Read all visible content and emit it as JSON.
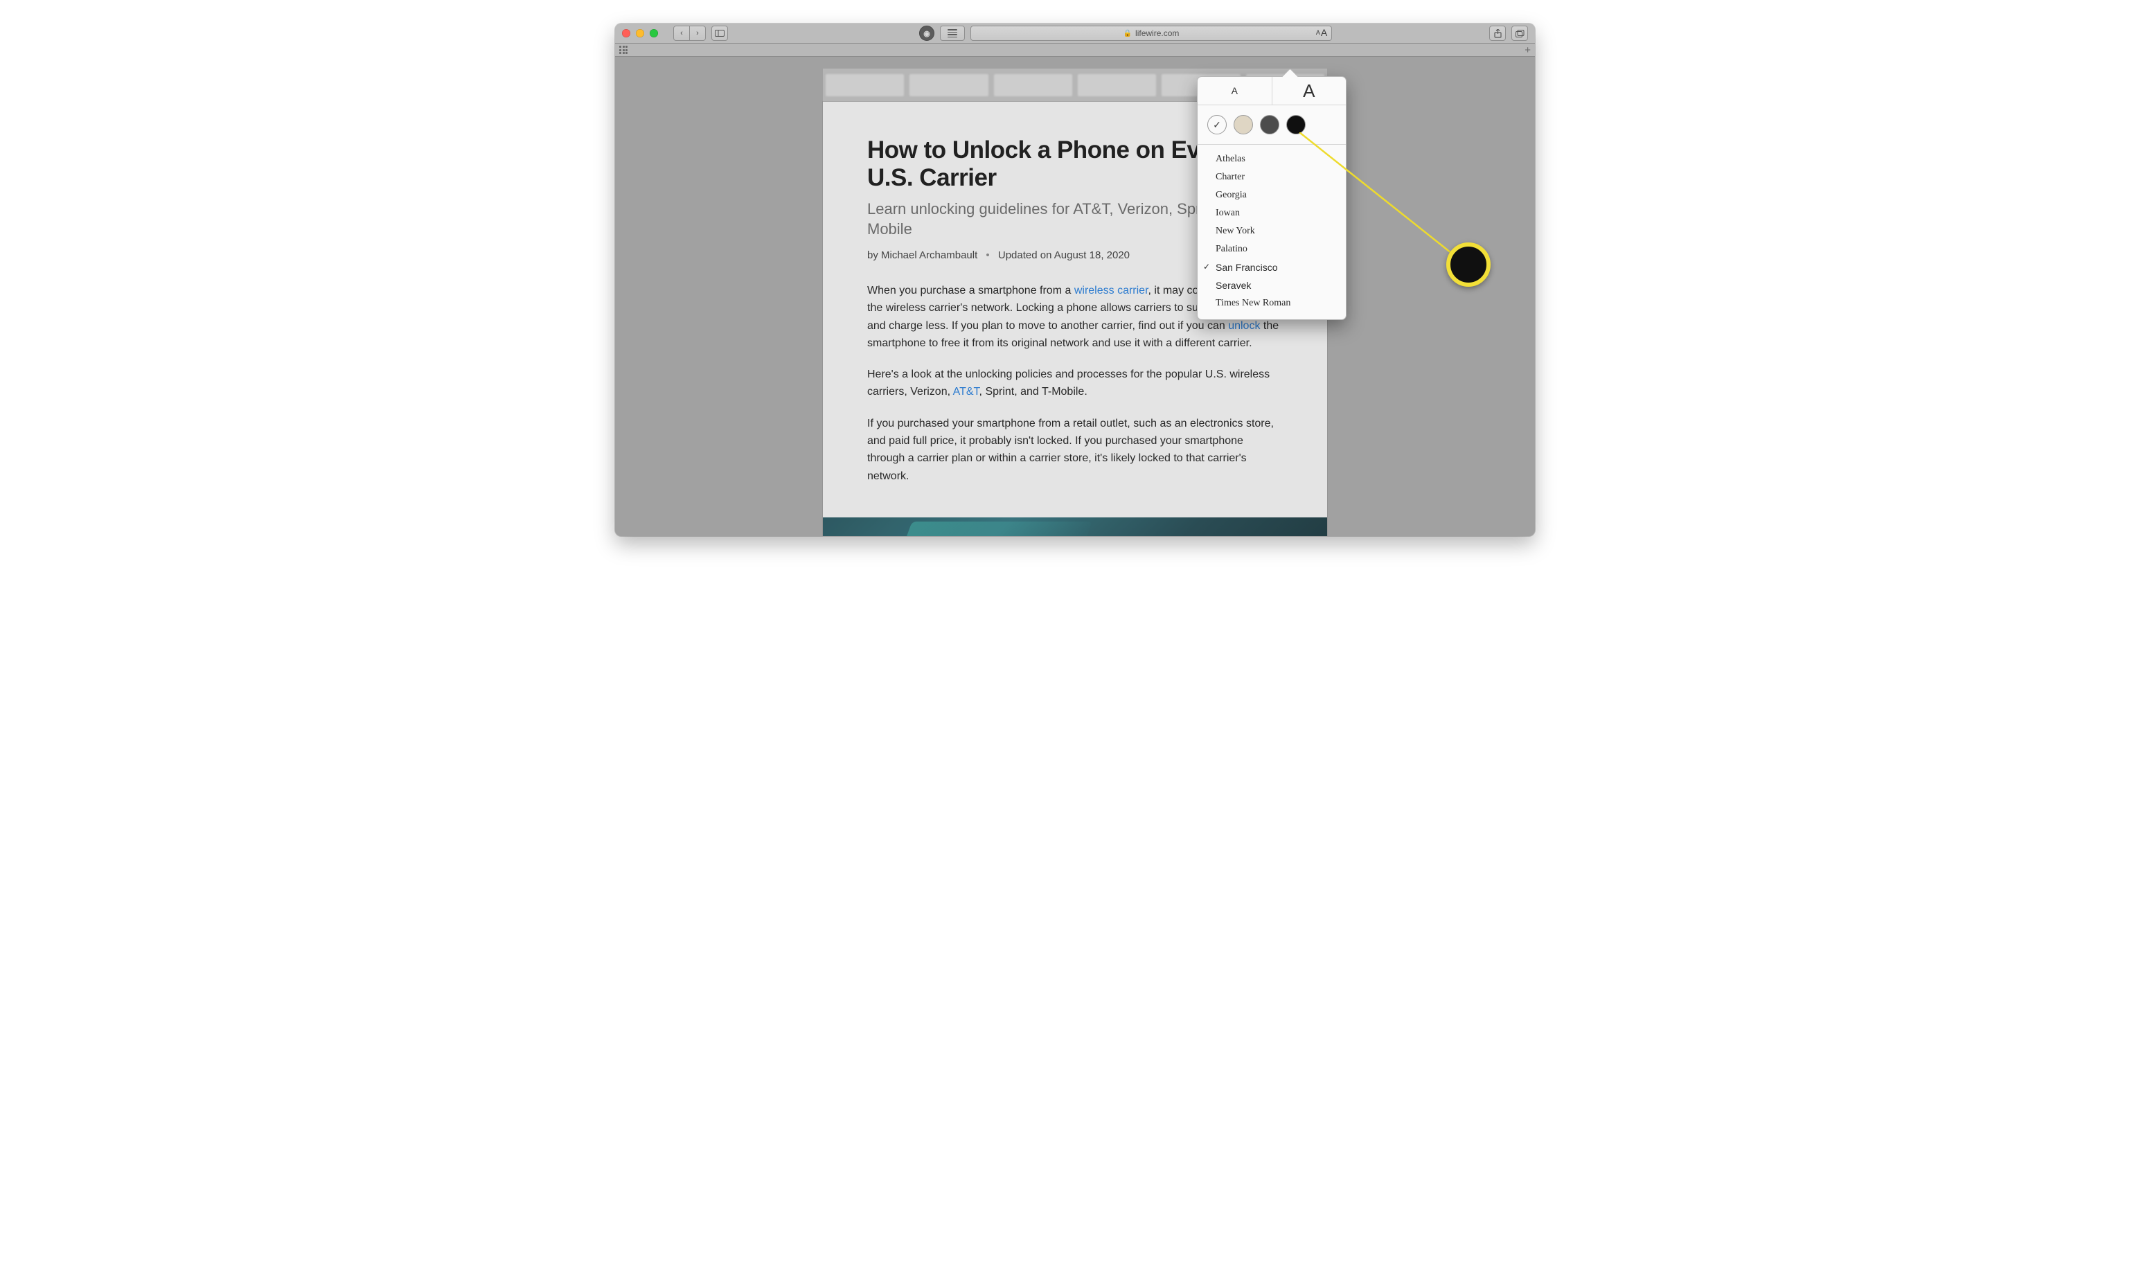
{
  "toolbar": {
    "url_host": "lifewire.com",
    "privacy_glyph": "◉",
    "reader_glyph": "AA"
  },
  "article": {
    "title": "How to Unlock a Phone on Every U.S. Carrier",
    "subtitle": "Learn unlocking guidelines for AT&T, Verizon, Sprint, and T-Mobile",
    "byline_prefix": "by ",
    "author": "Michael Archambault",
    "updated_prefix": "Updated on ",
    "updated_date": "August 18, 2020",
    "p1_a": "When you purchase a smartphone from a ",
    "p1_link1": "wireless carrier",
    "p1_b": ", it may come restricted to the wireless carrier's network. Locking a phone allows carriers to subsidize phones and charge less. If you plan to move to another carrier, find out if you can ",
    "p1_link2": "unlock",
    "p1_c": " the smartphone to free it from its original network and use it with a different carrier.",
    "p2_a": "Here's a look at the unlocking policies and processes for the popular U.S. wireless carriers, Verizon, ",
    "p2_link1": "AT&T",
    "p2_b": ", Sprint, and T-Mobile.",
    "p3": "If you purchased your smartphone from a retail outlet, such as an electronics store, and paid full price, it probably isn't locked. If you purchased your smartphone through a carrier plan or within a carrier store, it's likely locked to that carrier's network."
  },
  "popover": {
    "size_small": "A",
    "size_large": "A",
    "swatch_check": "✓",
    "swatches": {
      "white": "#ffffff",
      "sepia": "#e4dbc8",
      "gray": "#4e4e4e",
      "black": "#111111"
    },
    "fonts": [
      {
        "label": "Athelas",
        "cls": "font-athelas",
        "selected": false
      },
      {
        "label": "Charter",
        "cls": "font-charter",
        "selected": false
      },
      {
        "label": "Georgia",
        "cls": "font-georgia",
        "selected": false
      },
      {
        "label": "Iowan",
        "cls": "font-iowan",
        "selected": false
      },
      {
        "label": "New York",
        "cls": "font-newyork",
        "selected": false
      },
      {
        "label": "Palatino",
        "cls": "font-palatino",
        "selected": false
      },
      {
        "label": "San Francisco",
        "cls": "font-sanfrancisco",
        "selected": true
      },
      {
        "label": "Seravek",
        "cls": "font-seravek",
        "selected": false
      },
      {
        "label": "Times New Roman",
        "cls": "font-tnr",
        "selected": false
      }
    ]
  }
}
